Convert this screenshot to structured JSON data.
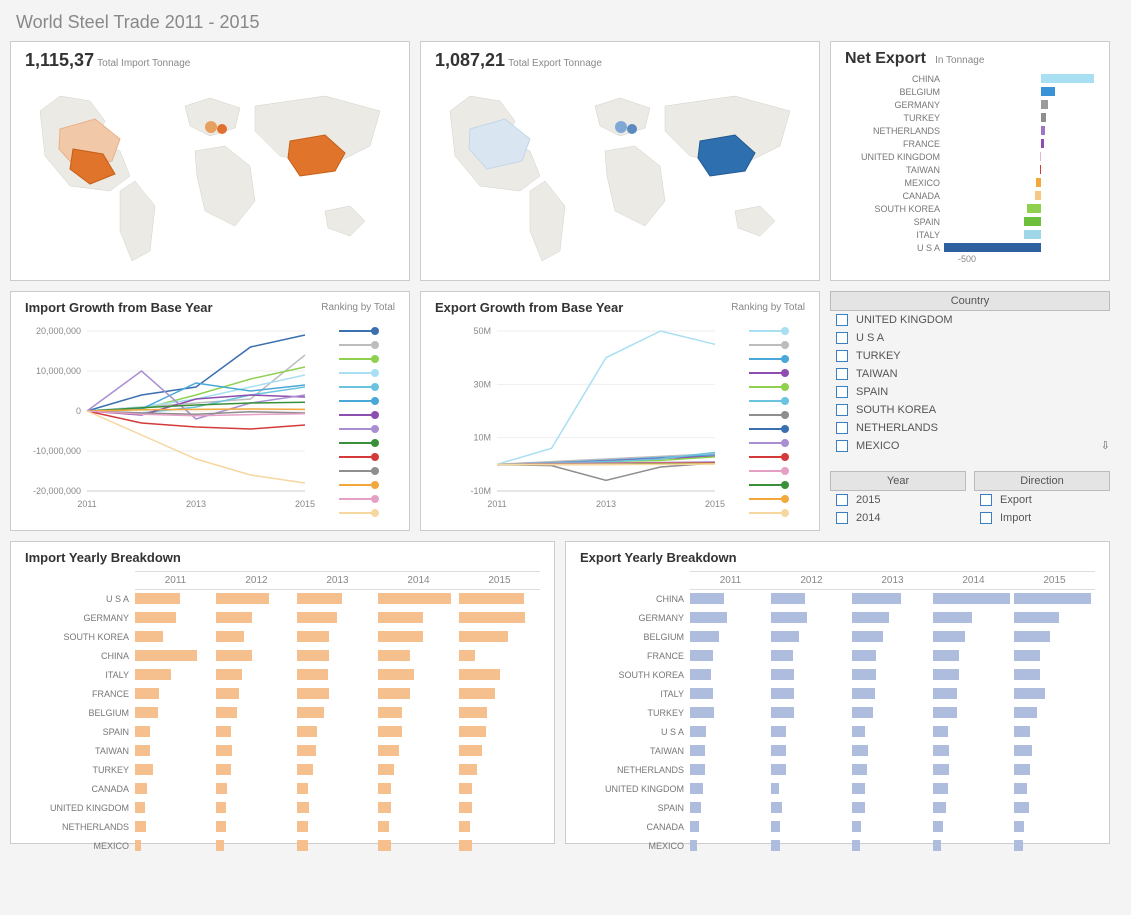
{
  "title": "World Steel Trade 2011 - 2015",
  "kpi_import": {
    "value": "1,115,37",
    "label": "Total Import Tonnage"
  },
  "kpi_export": {
    "value": "1,087,21",
    "label": "Total Export Tonnage"
  },
  "net_export": {
    "title": "Net Export",
    "subtitle": "In Tonnage",
    "axis_label": "-500"
  },
  "growth": {
    "import_title": "Import Growth from Base Year",
    "export_title": "Export Growth from Base Year",
    "ranking_label": "Ranking by Total"
  },
  "filters": {
    "country_title": "Country",
    "year_title": "Year",
    "direction_title": "Direction",
    "countries": [
      "UNITED KINGDOM",
      "U S A",
      "TURKEY",
      "TAIWAN",
      "SPAIN",
      "SOUTH KOREA",
      "NETHERLANDS",
      "MEXICO"
    ],
    "years": [
      "2015",
      "2014"
    ],
    "directions": [
      "Export",
      "Import"
    ]
  },
  "breakdown": {
    "import_title": "Import Yearly Breakdown",
    "export_title": "Export Yearly Breakdown",
    "years": [
      "2011",
      "2012",
      "2013",
      "2014",
      "2015"
    ]
  },
  "chart_data": {
    "net_export_bar": {
      "type": "bar",
      "orientation": "horizontal",
      "title": "Net Export",
      "ylabel": "In Tonnage",
      "xrange": [
        -550,
        300
      ],
      "zero_at": 0,
      "series": [
        {
          "name": "CHINA",
          "value": 300,
          "color": "#a8dff2"
        },
        {
          "name": "BELGIUM",
          "value": 80,
          "color": "#3a93d6"
        },
        {
          "name": "GERMANY",
          "value": 40,
          "color": "#9a9a9a"
        },
        {
          "name": "TURKEY",
          "value": 30,
          "color": "#8e8e8e"
        },
        {
          "name": "NETHERLANDS",
          "value": 22,
          "color": "#a074c7"
        },
        {
          "name": "FRANCE",
          "value": 18,
          "color": "#8c4fb0"
        },
        {
          "name": "UNITED KINGDOM",
          "value": -8,
          "color": "#e6b3d1"
        },
        {
          "name": "TAIWAN",
          "value": -8,
          "color": "#d43a3a"
        },
        {
          "name": "MEXICO",
          "value": -30,
          "color": "#f2a83b"
        },
        {
          "name": "CANADA",
          "value": -35,
          "color": "#f5c985"
        },
        {
          "name": "SOUTH KOREA",
          "value": -80,
          "color": "#8fd14f"
        },
        {
          "name": "SPAIN",
          "value": -95,
          "color": "#6fbf3f"
        },
        {
          "name": "ITALY",
          "value": -98,
          "color": "#9fd6e8"
        },
        {
          "name": "U S A",
          "value": -550,
          "color": "#2e5f9e"
        }
      ]
    },
    "import_growth": {
      "type": "line",
      "title": "Import Growth from Base Year",
      "xlabel": "",
      "ylabel": "",
      "x": [
        2011,
        2012,
        2013,
        2014,
        2015
      ],
      "ylim": [
        -20000000,
        20000000
      ],
      "yticks": [
        -20000000,
        -10000000,
        0,
        10000000,
        20000000
      ],
      "ytick_labels": [
        "-20,000,000",
        "-10,000,000",
        "0",
        "10,000,000",
        "20,000,000"
      ],
      "legend_colors": [
        "#3a6fb0",
        "#bdbdbd",
        "#8fd14f",
        "#a8dff2",
        "#6cc3e0",
        "#4aa8d8",
        "#8c4fb0",
        "#a98fd1",
        "#3a8f3a",
        "#d43a3a",
        "#8e8e8e",
        "#f2a83b",
        "#e6a0c5",
        "#f5d79f"
      ],
      "series": [
        {
          "name": "U S A",
          "color": "#3a6fb0",
          "values": [
            0,
            4000000,
            6000000,
            16000000,
            19000000
          ]
        },
        {
          "name": "GERMANY",
          "color": "#bdbdbd",
          "values": [
            0,
            1000000,
            2000000,
            3000000,
            14000000
          ]
        },
        {
          "name": "SOUTH KOREA",
          "color": "#8fd14f",
          "values": [
            0,
            500000,
            4000000,
            8000000,
            11000000
          ]
        },
        {
          "name": "CHINA",
          "color": "#a8dff2",
          "values": [
            0,
            1000000,
            3000000,
            6000000,
            9000000
          ]
        },
        {
          "name": "ITALY",
          "color": "#6cc3e0",
          "values": [
            0,
            -500000,
            1000000,
            4000000,
            6000000
          ]
        },
        {
          "name": "FRANCE",
          "color": "#4aa8d8",
          "values": [
            0,
            500000,
            7000000,
            5000000,
            6500000
          ]
        },
        {
          "name": "BELGIUM",
          "color": "#8c4fb0",
          "values": [
            0,
            -1000000,
            3000000,
            4000000,
            3500000
          ]
        },
        {
          "name": "SPAIN",
          "color": "#a98fd1",
          "values": [
            0,
            10000000,
            -2000000,
            2000000,
            4000000
          ]
        },
        {
          "name": "TAIWAN",
          "color": "#3a8f3a",
          "values": [
            0,
            800000,
            1500000,
            2000000,
            2200000
          ]
        },
        {
          "name": "TURKEY",
          "color": "#d43a3a",
          "values": [
            0,
            -3000000,
            -4000000,
            -4500000,
            -3500000
          ]
        },
        {
          "name": "CANADA",
          "color": "#8e8e8e",
          "values": [
            0,
            -500000,
            -800000,
            -200000,
            -500000
          ]
        },
        {
          "name": "UK",
          "color": "#f2a83b",
          "values": [
            0,
            300000,
            400000,
            500000,
            400000
          ]
        },
        {
          "name": "NETHERLANDS",
          "color": "#e6a0c5",
          "values": [
            0,
            -800000,
            -1200000,
            -900000,
            -700000
          ]
        },
        {
          "name": "MEXICO",
          "color": "#f5d79f",
          "values": [
            0,
            -6000000,
            -12000000,
            -16000000,
            -18000000
          ]
        }
      ]
    },
    "export_growth": {
      "type": "line",
      "title": "Export Growth from Base Year",
      "x": [
        2011,
        2012,
        2013,
        2014,
        2015
      ],
      "ylim": [
        -10000000,
        50000000
      ],
      "yticks": [
        -10000000,
        10000000,
        30000000,
        50000000
      ],
      "ytick_labels": [
        "-10M",
        "10M",
        "30M",
        "50M"
      ],
      "legend_colors": [
        "#a8dff2",
        "#bdbdbd",
        "#4aa8d8",
        "#8c4fb0",
        "#8fd14f",
        "#6cc3e0",
        "#8e8e8e",
        "#3a6fb0",
        "#a98fd1",
        "#d43a3a",
        "#e6a0c5",
        "#3a8f3a",
        "#f2a83b",
        "#f5d79f"
      ],
      "series": [
        {
          "name": "CHINA",
          "color": "#a8dff2",
          "values": [
            0,
            6000000,
            40000000,
            50000000,
            45000000
          ]
        },
        {
          "name": "GERMANY",
          "color": "#bdbdbd",
          "values": [
            0,
            1000000,
            2000000,
            3000000,
            4000000
          ]
        },
        {
          "name": "BELGIUM",
          "color": "#4aa8d8",
          "values": [
            0,
            600000,
            1500000,
            2500000,
            3500000
          ]
        },
        {
          "name": "FRANCE",
          "color": "#8c4fb0",
          "values": [
            0,
            500000,
            1200000,
            2200000,
            3000000
          ]
        },
        {
          "name": "SOUTH KOREA",
          "color": "#8fd14f",
          "values": [
            0,
            400000,
            1000000,
            1500000,
            2800000
          ]
        },
        {
          "name": "ITALY",
          "color": "#6cc3e0",
          "values": [
            0,
            500000,
            1000000,
            2000000,
            4500000
          ]
        },
        {
          "name": "TURKEY",
          "color": "#8e8e8e",
          "values": [
            0,
            -500000,
            -6000000,
            -1000000,
            500000
          ]
        },
        {
          "name": "U S A",
          "color": "#3a6fb0",
          "values": [
            0,
            200000,
            400000,
            600000,
            700000
          ]
        },
        {
          "name": "TAIWAN",
          "color": "#a98fd1",
          "values": [
            0,
            300000,
            500000,
            700000,
            900000
          ]
        },
        {
          "name": "NETHERLANDS",
          "color": "#d43a3a",
          "values": [
            0,
            100000,
            300000,
            500000,
            600000
          ]
        },
        {
          "name": "UK",
          "color": "#e6a0c5",
          "values": [
            0,
            100000,
            200000,
            300000,
            400000
          ]
        },
        {
          "name": "SPAIN",
          "color": "#3a8f3a",
          "values": [
            0,
            -50000,
            100000,
            200000,
            300000
          ]
        },
        {
          "name": "CANADA",
          "color": "#f2a83b",
          "values": [
            0,
            -80000,
            -60000,
            100000,
            200000
          ]
        },
        {
          "name": "MEXICO",
          "color": "#f5d79f",
          "values": [
            0,
            -90000,
            -50000,
            -30000,
            100000
          ]
        }
      ]
    },
    "import_breakdown": {
      "type": "bar",
      "years": [
        "2011",
        "2012",
        "2013",
        "2014",
        "2015"
      ],
      "max": 100,
      "rows": [
        {
          "name": "U S A",
          "values": [
            55,
            66,
            55,
            90,
            80
          ]
        },
        {
          "name": "GERMANY",
          "values": [
            50,
            45,
            49,
            56,
            82
          ]
        },
        {
          "name": "SOUTH KOREA",
          "values": [
            35,
            35,
            40,
            55,
            60
          ]
        },
        {
          "name": "CHINA",
          "values": [
            77,
            45,
            40,
            40,
            20
          ]
        },
        {
          "name": "ITALY",
          "values": [
            45,
            32,
            38,
            44,
            50
          ]
        },
        {
          "name": "FRANCE",
          "values": [
            30,
            28,
            40,
            40,
            45
          ]
        },
        {
          "name": "BELGIUM",
          "values": [
            28,
            26,
            33,
            30,
            35
          ]
        },
        {
          "name": "SPAIN",
          "values": [
            18,
            18,
            25,
            30,
            33
          ]
        },
        {
          "name": "TAIWAN",
          "values": [
            18,
            20,
            23,
            26,
            28
          ]
        },
        {
          "name": "TURKEY",
          "values": [
            22,
            19,
            20,
            20,
            22
          ]
        },
        {
          "name": "CANADA",
          "values": [
            15,
            14,
            14,
            16,
            16
          ]
        },
        {
          "name": "UNITED KINGDOM",
          "values": [
            12,
            12,
            15,
            16,
            16
          ]
        },
        {
          "name": "NETHERLANDS",
          "values": [
            14,
            12,
            13,
            14,
            14
          ]
        },
        {
          "name": "MEXICO",
          "values": [
            8,
            10,
            14,
            16,
            16
          ]
        }
      ]
    },
    "export_breakdown": {
      "type": "bar",
      "years": [
        "2011",
        "2012",
        "2013",
        "2014",
        "2015"
      ],
      "max": 100,
      "rows": [
        {
          "name": "CHINA",
          "values": [
            42,
            42,
            60,
            95,
            95
          ]
        },
        {
          "name": "GERMANY",
          "values": [
            46,
            44,
            46,
            48,
            55
          ]
        },
        {
          "name": "BELGIUM",
          "values": [
            36,
            34,
            38,
            40,
            45
          ]
        },
        {
          "name": "FRANCE",
          "values": [
            28,
            27,
            30,
            32,
            32
          ]
        },
        {
          "name": "SOUTH KOREA",
          "values": [
            26,
            28,
            30,
            32,
            32
          ]
        },
        {
          "name": "ITALY",
          "values": [
            28,
            28,
            28,
            30,
            38
          ]
        },
        {
          "name": "TURKEY",
          "values": [
            30,
            28,
            26,
            30,
            28
          ]
        },
        {
          "name": "U S A",
          "values": [
            20,
            18,
            16,
            18,
            20
          ]
        },
        {
          "name": "TAIWAN",
          "values": [
            18,
            18,
            20,
            20,
            22
          ]
        },
        {
          "name": "NETHERLANDS",
          "values": [
            18,
            18,
            18,
            20,
            20
          ]
        },
        {
          "name": "UNITED KINGDOM",
          "values": [
            16,
            10,
            16,
            18,
            16
          ]
        },
        {
          "name": "SPAIN",
          "values": [
            14,
            14,
            16,
            16,
            18
          ]
        },
        {
          "name": "CANADA",
          "values": [
            11,
            11,
            11,
            12,
            12
          ]
        },
        {
          "name": "MEXICO",
          "values": [
            9,
            11,
            10,
            10,
            11
          ]
        }
      ]
    }
  }
}
